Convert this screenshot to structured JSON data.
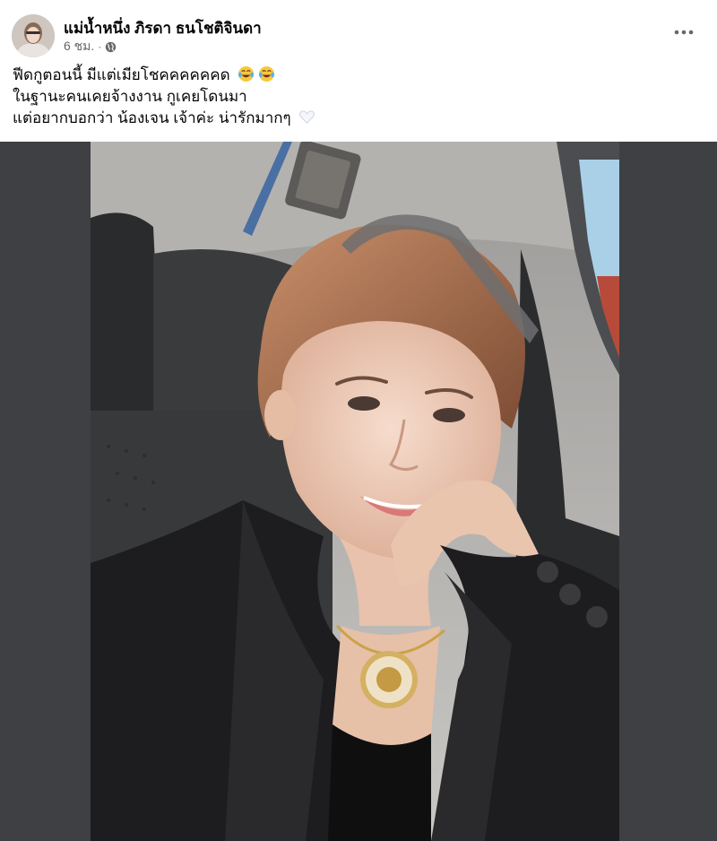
{
  "post": {
    "author": {
      "name": "แม่น้ำหนึ่ง ภิรดา ธนโชติจินดา",
      "avatar_icon": "profile-photo"
    },
    "meta": {
      "time": "6 ชม.",
      "separator": "·",
      "privacy_icon": "globe-icon"
    },
    "more_icon": "three-dots-icon",
    "text_lines": [
      "ฟีดกูตอนนี้ มีแต่เมียโชคคคคคคด",
      "ในฐานะคนเคยจ้างงาน  กูเคยโดนมา",
      "แต่อยากบอกว่า  น้องเจน เจ้าค่ะ น่ารักมากๆ"
    ],
    "line1_emojis": [
      "laughing-tears-emoji",
      "laughing-tears-emoji"
    ],
    "line3_emoji": "white-heart-emoji",
    "photo": {
      "subject": "selfie-photo"
    },
    "colors": {
      "media_background": "#3e4043",
      "text": "#050505",
      "secondary_text": "#65676b"
    }
  }
}
